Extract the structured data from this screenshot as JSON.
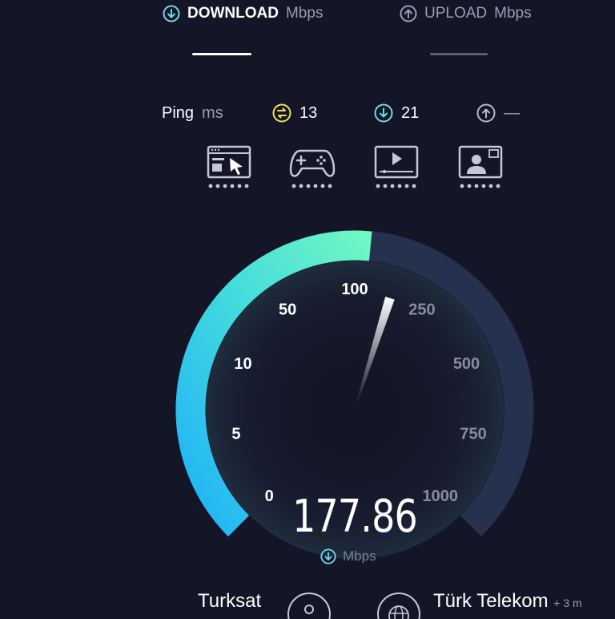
{
  "tabs": {
    "download": {
      "label": "DOWNLOAD",
      "unit": "Mbps"
    },
    "upload": {
      "label": "UPLOAD",
      "unit": "Mbps"
    }
  },
  "ping": {
    "label": "Ping",
    "unit": "ms",
    "idle": "13",
    "download": "21",
    "upload": "—"
  },
  "apps": [
    {
      "icon": "web-browsing-icon"
    },
    {
      "icon": "gaming-icon"
    },
    {
      "icon": "video-streaming-icon"
    },
    {
      "icon": "video-chat-icon"
    }
  ],
  "gauge": {
    "ticks": [
      "0",
      "5",
      "10",
      "50",
      "100",
      "250",
      "500",
      "750",
      "1000"
    ],
    "value": 177.86,
    "value_text": "177.86",
    "unit": "Mbps"
  },
  "server": {
    "isp": "Turksat",
    "host": "Türk Telekom",
    "extra": "+ 3 m"
  },
  "colors": {
    "background": "#141526",
    "gauge_start": "#2bb8f5",
    "gauge_end": "#6ef5c4",
    "gauge_track": "#26314f",
    "ping_idle": "#f3e05a",
    "ping_download": "#74d8e8"
  }
}
